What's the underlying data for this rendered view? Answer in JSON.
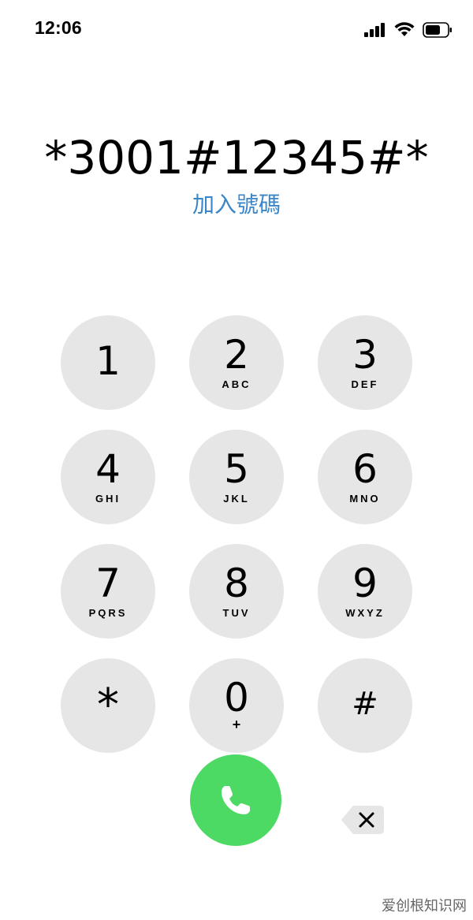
{
  "status_bar": {
    "time": "12:06",
    "icons": [
      "cellular-signal-icon",
      "wifi-icon",
      "battery-icon"
    ]
  },
  "dialer": {
    "dialed_number": "*3001#12345#*",
    "add_number_label": "加入號碼",
    "accent_color": "#3a86c8"
  },
  "keypad": {
    "keys": [
      {
        "digit": "1",
        "letters": ""
      },
      {
        "digit": "2",
        "letters": "ABC"
      },
      {
        "digit": "3",
        "letters": "DEF"
      },
      {
        "digit": "4",
        "letters": "GHI"
      },
      {
        "digit": "5",
        "letters": "JKL"
      },
      {
        "digit": "6",
        "letters": "MNO"
      },
      {
        "digit": "7",
        "letters": "PQRS"
      },
      {
        "digit": "8",
        "letters": "TUV"
      },
      {
        "digit": "9",
        "letters": "WXYZ"
      },
      {
        "digit": "*",
        "letters": ""
      },
      {
        "digit": "0",
        "letters": "+"
      },
      {
        "digit": "#",
        "letters": ""
      }
    ],
    "key_color": "#e6e6e6"
  },
  "actions": {
    "call_icon": "phone-icon",
    "call_color": "#4cd964",
    "delete_icon": "backspace-icon"
  },
  "watermark": {
    "text": "爱创根知识网"
  }
}
